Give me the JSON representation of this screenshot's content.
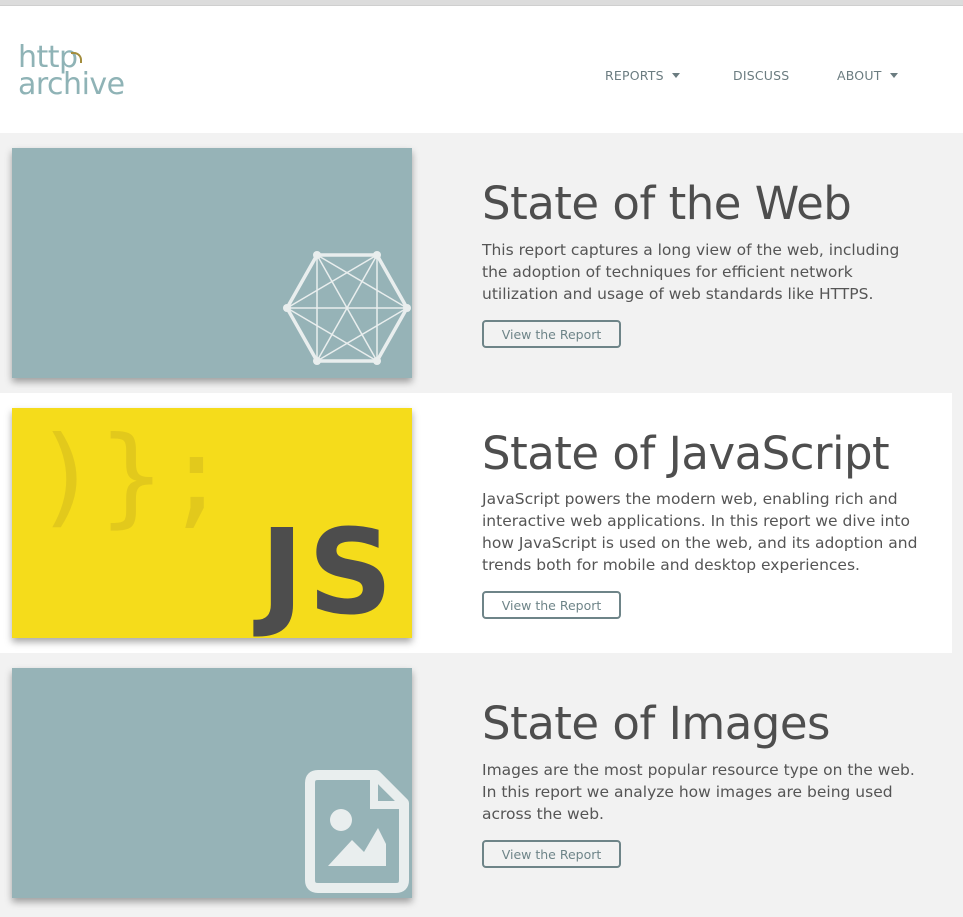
{
  "logo": {
    "line1": "http",
    "line2": "archive"
  },
  "nav": {
    "reports": "REPORTS",
    "discuss": "DISCUSS",
    "about": "ABOUT"
  },
  "reports": [
    {
      "title": "State of the Web",
      "description": "This report captures a long view of the web, including the adoption of techniques for efficient network utilization and usage of web standards like HTTPS.",
      "button": "View the Report"
    },
    {
      "title": "State of JavaScript",
      "description": "JavaScript powers the modern web, enabling rich and interactive web applications. In this report we dive into how JavaScript is used on the web, and its adoption and trends both for mobile and desktop experiences.",
      "button": "View the Report",
      "thumb_text": "JS",
      "thumb_bg_text": ")};"
    },
    {
      "title": "State of Images",
      "description": "Images are the most popular resource type on the web. In this report we analyze how images are being used across the web.",
      "button": "View the Report"
    }
  ],
  "colors": {
    "brand_teal": "#8fb3b6",
    "card_teal": "#96b3b7",
    "js_yellow": "#f5dc1b",
    "text_dark": "#4e4e4e"
  },
  "icons": [
    "network-hexagon-icon",
    "image-file-icon"
  ]
}
